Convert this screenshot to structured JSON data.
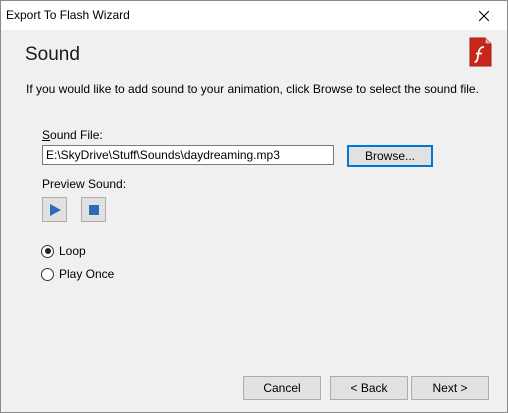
{
  "window": {
    "title": "Export To Flash Wizard"
  },
  "page": {
    "heading": "Sound",
    "instructions": "If you would like to add sound to your animation, click Browse to select the sound file."
  },
  "sound_file": {
    "label_accel": "S",
    "label_rest": "ound File:",
    "value": "E:\\SkyDrive\\Stuff\\Sounds\\daydreaming.mp3",
    "browse_label": "Browse..."
  },
  "preview": {
    "label": "Preview Sound:",
    "play_icon": "play-icon",
    "stop_icon": "stop-icon"
  },
  "playback": {
    "options": [
      {
        "label": "Loop",
        "selected": true
      },
      {
        "label": "Play Once",
        "selected": false
      }
    ]
  },
  "footer": {
    "cancel_label": "Cancel",
    "back_label": "< Back",
    "next_label": "Next >"
  },
  "colors": {
    "accent": "#0078d7",
    "media_icon": "#2b6cb8",
    "flash_red": "#c8261b"
  }
}
